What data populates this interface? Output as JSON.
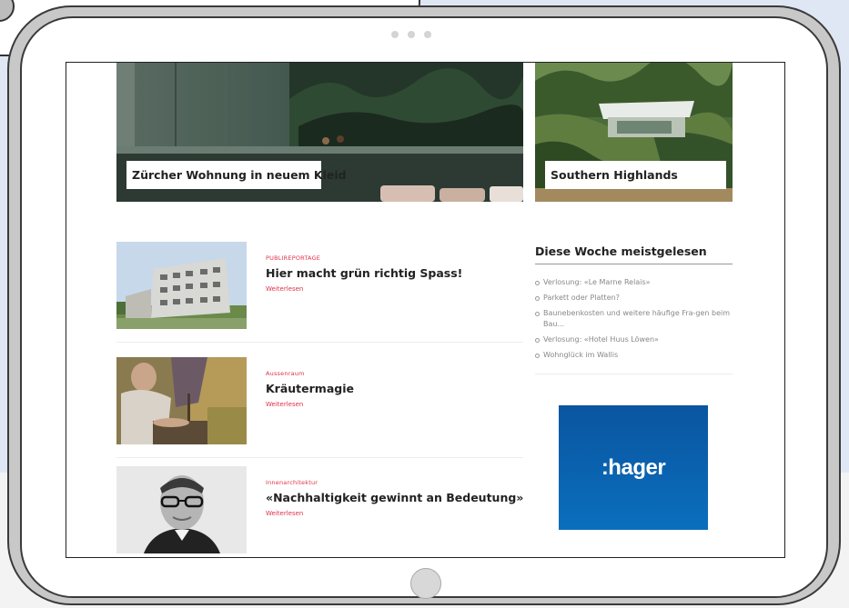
{
  "heroes": [
    {
      "label": "Zürcher Wohnung in neuem Kleid"
    },
    {
      "label": "Southern Highlands"
    }
  ],
  "articles": [
    {
      "category": "PUBLIREPORTAGE",
      "title": "Hier macht grün richtig Spass!",
      "readmore": "Weiterlesen"
    },
    {
      "category": "Aussenraum",
      "title": "Kräutermagie",
      "readmore": "Weiterlesen"
    },
    {
      "category": "Innenarchitektur",
      "title": "«Nachhaltigkeit gewinnt an Bedeutung»",
      "readmore": "Weiterlesen"
    }
  ],
  "sidebar": {
    "title": "Diese Woche meistgelesen",
    "items": [
      "Verlosung: «Le Marne Relais»",
      "Parkett oder Platten?",
      "Baunebenkosten und weitere häufige Fra-gen beim Bau...",
      "Verlosung: «Hotel Huus Löwen»",
      "Wohnglück im Wallis"
    ]
  },
  "ad": {
    "brand": ":hager",
    "color": "#0a5fae"
  }
}
